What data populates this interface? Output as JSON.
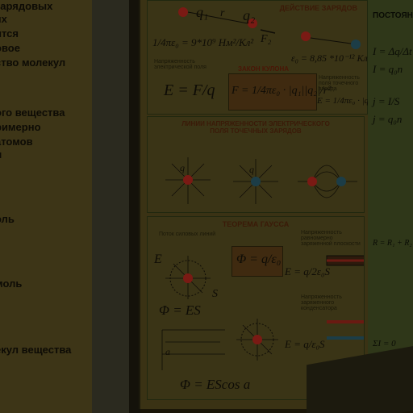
{
  "left_poster": {
    "lines": [
      "зарядовых",
      "ях",
      "ится",
      "овое",
      "ство молекул",
      "ого вещества",
      "римерно",
      "атомов",
      "л",
      "оль",
      "моль",
      "екул вещества"
    ]
  },
  "main_poster": {
    "header": "ДЕЙСТВИЕ ЗАРЯДОВ",
    "coulomb_constant": "1/4πε₀ = 9*10⁹ Нм²/Кл²",
    "epsilon0": "ε₀ = 8,85 *10⁻¹² Кл²/Нм²",
    "field_strength_label": "Напряженность электрической поля",
    "field_strength_formula": "E = F/q",
    "law_title": "ЗАКОН КУЛОНА",
    "law_formula": "F = 1/4πε₀ · |q₁||q₂|/r²",
    "point_field_label": "Напряженность поля точечного заряда",
    "point_field_formula": "E = 1/4πε₀ · |q|/r²",
    "field_lines_title": "ЛИНИИ НАПРЯЖЕННОСТИ ЭЛЕКТРИЧЕСКОГО ПОЛЯ ТОЧЕЧНЫХ ЗАРЯДОВ",
    "gauss_title": "ТЕОРЕМА ГАУССА",
    "flux_label": "Поток силовых линий",
    "gauss_formula": "Φ = q/ε₀",
    "plane_label": "Напряженность равномерно заряженной плоскости",
    "plane_formula": "E = q/2ε₀S",
    "capacitor_label": "Напряженность заряженного конденсатора",
    "capacitor_formula": "E = q/ε₀S",
    "flux_es": "Φ = ES",
    "flux_cos": "Φ = EScos a",
    "q1": "q₁",
    "q2": "q₂",
    "r": "r",
    "F1": "F₁",
    "F2": "F₂",
    "q": "q",
    "S": "S",
    "E": "E",
    "a": "a"
  },
  "right_poster": {
    "title": "ПОСТОЯННЫ",
    "lines": [
      "I = Δq/Δt",
      "I = q₀n",
      "j = I/S",
      "j = q₀n",
      "R = R₁ + R₂",
      "ΣI = 0"
    ]
  },
  "colors": {
    "positive_charge": "#7a1a14",
    "negative_charge": "#1c3d47",
    "panel_border": "#20270f"
  }
}
